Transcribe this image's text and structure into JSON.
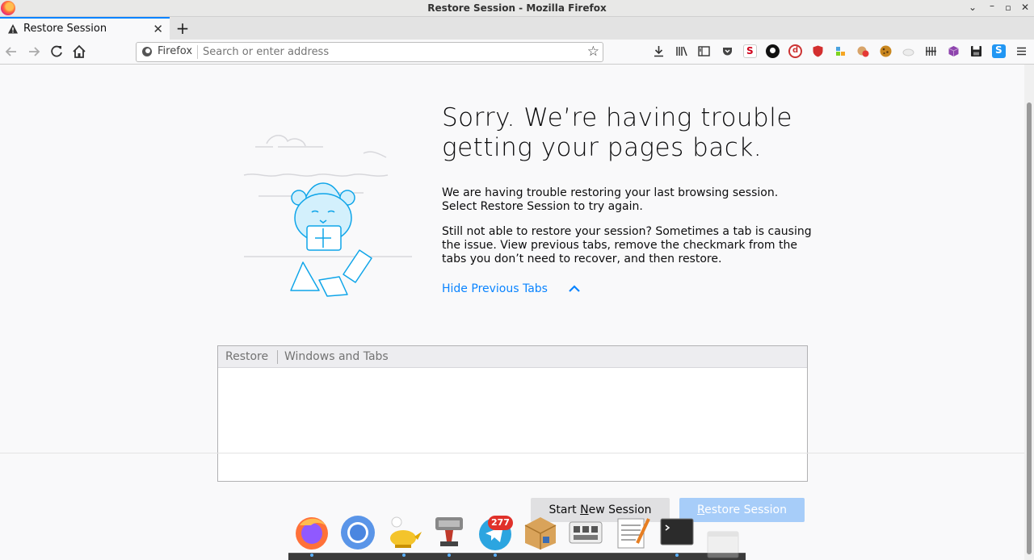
{
  "window": {
    "title": "Restore Session - Mozilla Firefox"
  },
  "tabs": [
    {
      "label": "Restore Session"
    }
  ],
  "urlbar": {
    "identity_label": "Firefox",
    "placeholder": "Search or enter address"
  },
  "toolbar_icons": [
    "download-icon",
    "library-icon",
    "sidebar-icon",
    "pocket-icon",
    "s-extension-icon",
    "cookie-extension-icon",
    "d-extension-icon",
    "shield-extension-icon",
    "puzzle-extension-icon",
    "cookie-autodelete-icon",
    "cookie-icon",
    "cloud-icon",
    "columns-icon",
    "cube-icon",
    "save-icon",
    "s-blue-icon",
    "menu-icon"
  ],
  "content": {
    "heading": "Sorry. We’re having trouble getting your pages back.",
    "para1": "We are having trouble restoring your last browsing session. Select Restore Session to try again.",
    "para2": "Still not able to restore your session? Sometimes a tab is causing the issue. View previous tabs, remove the checkmark from the tabs you don’t need to recover, and then restore.",
    "hide_tabs_link": "Hide Previous Tabs",
    "tree": {
      "columns": [
        "Restore",
        "Windows and Tabs"
      ]
    },
    "buttons": {
      "start_new_before": "Start ",
      "start_new_access": "N",
      "start_new_after": "ew Session",
      "restore_access": "R",
      "restore_after": "estore Session"
    }
  },
  "dock": {
    "items": [
      "firefox-icon",
      "chromium-icon",
      "genie-lamp-icon",
      "stamp-tool-icon",
      "telegram-icon",
      "package-icon",
      "keyboard-icon",
      "text-editor-icon",
      "terminal-icon",
      "window-icon"
    ],
    "telegram_badge": "277"
  },
  "colors": {
    "accent": "#0a84ff",
    "restore_button": "#a7cdf9",
    "background": "#f9f9fa"
  }
}
